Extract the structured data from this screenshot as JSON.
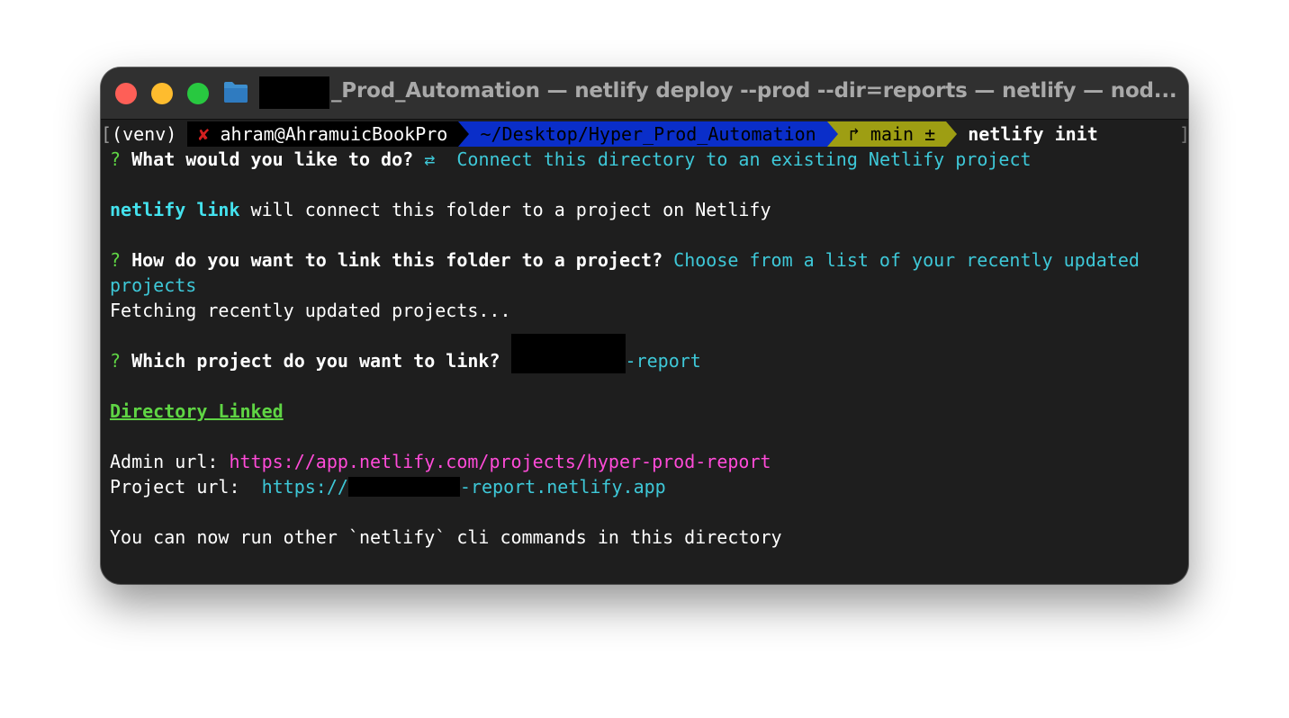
{
  "window": {
    "title": "_Prod_Automation — netlify deploy --prod --dir=reports — netlify — nod..."
  },
  "icons": {
    "folder": "folder-icon",
    "cross": "✘",
    "git_branch": "↱"
  },
  "prompt": {
    "open_bracket": "[",
    "venv": "(venv)",
    "user_host": "ahram@AhramuicBookPro",
    "path": "~/Desktop/Hyper_Prod_Automation",
    "branch": "main ±",
    "command": "netlify init",
    "close_bracket": "]"
  },
  "output": {
    "q1_mark": "?",
    "q1_question": "What would you like to do?",
    "q1_arrow": "⇄",
    "q1_answer": "Connect this directory to an existing Netlify project",
    "link_cmd": "netlify link",
    "link_text": "will connect this folder to a project on Netlify",
    "q2_mark": "?",
    "q2_question": "How do you want to link this folder to a project?",
    "q2_answer_1": "Choose from a list of your recently updated",
    "q2_answer_2": "projects",
    "fetching": "Fetching recently updated projects...",
    "q3_mark": "?",
    "q3_question": "Which project do you want to link?",
    "q3_answer_suffix": "-report",
    "linked": "Directory Linked",
    "admin_label": "Admin url:",
    "admin_url": "https://app.netlify.com/projects/hyper-prod-report",
    "project_label": "Project url:",
    "project_url_prefix": "https://",
    "project_url_suffix": "-report.netlify.app",
    "final": "You can now run other `netlify` cli commands in this directory"
  },
  "colors": {
    "background": "#1e1e1e",
    "titlebar": "#303030",
    "cyan": "#3ec8d8",
    "green": "#5fd544",
    "magenta": "#ff4bd8",
    "path_segment": "#0a2ec9",
    "git_segment": "#9e9e13"
  }
}
